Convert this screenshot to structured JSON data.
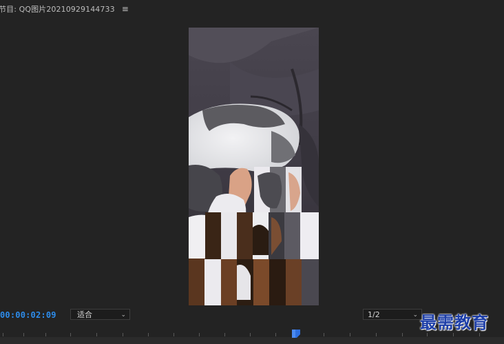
{
  "header": {
    "title": "节目: QQ图片20210929144733",
    "menu_icon": "hamburger-menu-icon",
    "menu_glyph": "≡"
  },
  "viewer": {
    "image": "cat-sleeping-on-couch-with-mosaic-transition"
  },
  "controls": {
    "timecode": "00:00:02:09",
    "fit_value": "适合",
    "resolution_value": "1/2",
    "chevron_glyph": "⌄"
  },
  "watermark": {
    "text": "最需教育"
  },
  "colors": {
    "background": "#232323",
    "timecode_accent": "#2d8ceb",
    "playhead": "#2d6fe0",
    "watermark": "#1e3fa8"
  }
}
